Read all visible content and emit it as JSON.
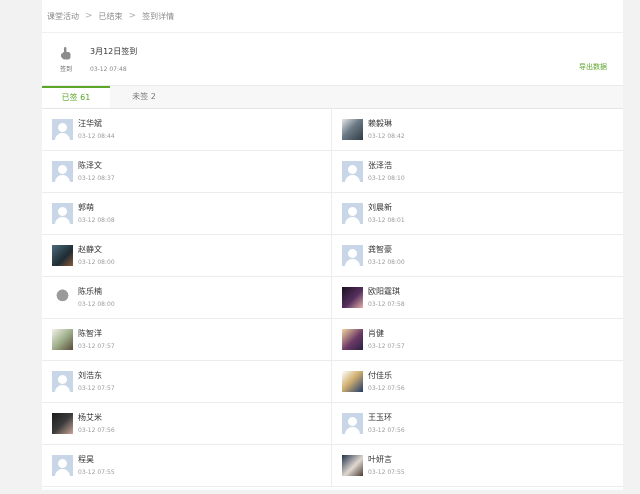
{
  "breadcrumb": [
    "课堂活动",
    "已结束",
    "签到详情"
  ],
  "activity": {
    "icon_label": "签到",
    "title": "3月12日签到",
    "time": "03-12 07:48",
    "export_label": "导出数据"
  },
  "tabs": [
    {
      "label": "已签 61",
      "active": true
    },
    {
      "label": "未签 2",
      "active": false
    }
  ],
  "students": [
    {
      "name": "汪华斌",
      "time": "03-12 08:44",
      "avatar": "default"
    },
    {
      "name": "赖毅琳",
      "time": "03-12 08:42",
      "avatar": "photo1"
    },
    {
      "name": "陈泽文",
      "time": "03-12 08:37",
      "avatar": "default"
    },
    {
      "name": "张泽浩",
      "time": "03-12 08:10",
      "avatar": "default"
    },
    {
      "name": "郭萌",
      "time": "03-12 08:08",
      "avatar": "default"
    },
    {
      "name": "刘晨新",
      "time": "03-12 08:01",
      "avatar": "default"
    },
    {
      "name": "赵静文",
      "time": "03-12 08:00",
      "avatar": "photo2"
    },
    {
      "name": "龚智豪",
      "time": "03-12 08:00",
      "avatar": "default"
    },
    {
      "name": "陈乐楠",
      "time": "03-12 08:00",
      "avatar": "photo3"
    },
    {
      "name": "欧阳霆琪",
      "time": "03-12 07:58",
      "avatar": "photo4"
    },
    {
      "name": "陈智洋",
      "time": "03-12 07:57",
      "avatar": "photo5"
    },
    {
      "name": "肖健",
      "time": "03-12 07:57",
      "avatar": "photo6"
    },
    {
      "name": "刘浩东",
      "time": "03-12 07:57",
      "avatar": "default"
    },
    {
      "name": "付佳乐",
      "time": "03-12 07:56",
      "avatar": "photo7"
    },
    {
      "name": "杨艾米",
      "time": "03-12 07:56",
      "avatar": "photo8"
    },
    {
      "name": "王玉环",
      "time": "03-12 07:56",
      "avatar": "default"
    },
    {
      "name": "程昊",
      "time": "03-12 07:55",
      "avatar": "default"
    },
    {
      "name": "叶妍言",
      "time": "03-12 07:55",
      "avatar": "photo9"
    }
  ]
}
